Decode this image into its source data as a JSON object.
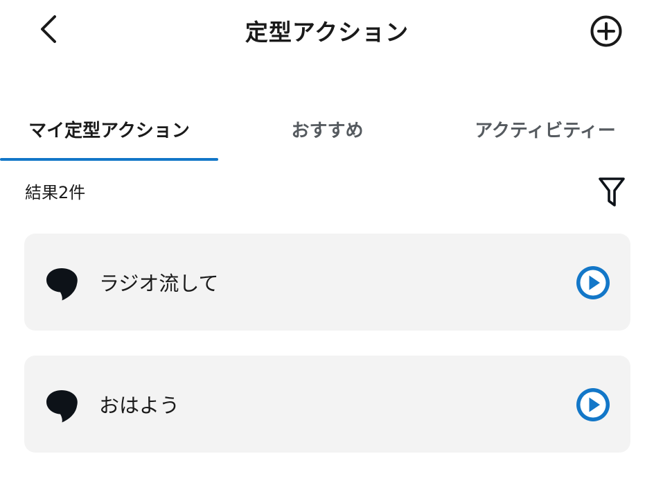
{
  "header": {
    "title": "定型アクション",
    "back_icon": "chevron-left-icon",
    "add_icon": "plus-circle-icon"
  },
  "tabs": [
    {
      "label": "マイ定型アクション",
      "active": true
    },
    {
      "label": "おすすめ",
      "active": false
    },
    {
      "label": "アクティビティー",
      "active": false
    }
  ],
  "results": {
    "count_label": "結果2件",
    "filter_icon": "filter-icon"
  },
  "routines": [
    {
      "label": "ラジオ流して",
      "icon": "speech-bubble-icon",
      "action_icon": "play-icon"
    },
    {
      "label": "おはよう",
      "icon": "speech-bubble-icon",
      "action_icon": "play-icon"
    }
  ],
  "colors": {
    "accent": "#1377c8",
    "card_background": "#f3f3f3",
    "text_primary": "#1a1a1a",
    "text_secondary": "#555a5f",
    "icon_dark": "#0d1218"
  }
}
